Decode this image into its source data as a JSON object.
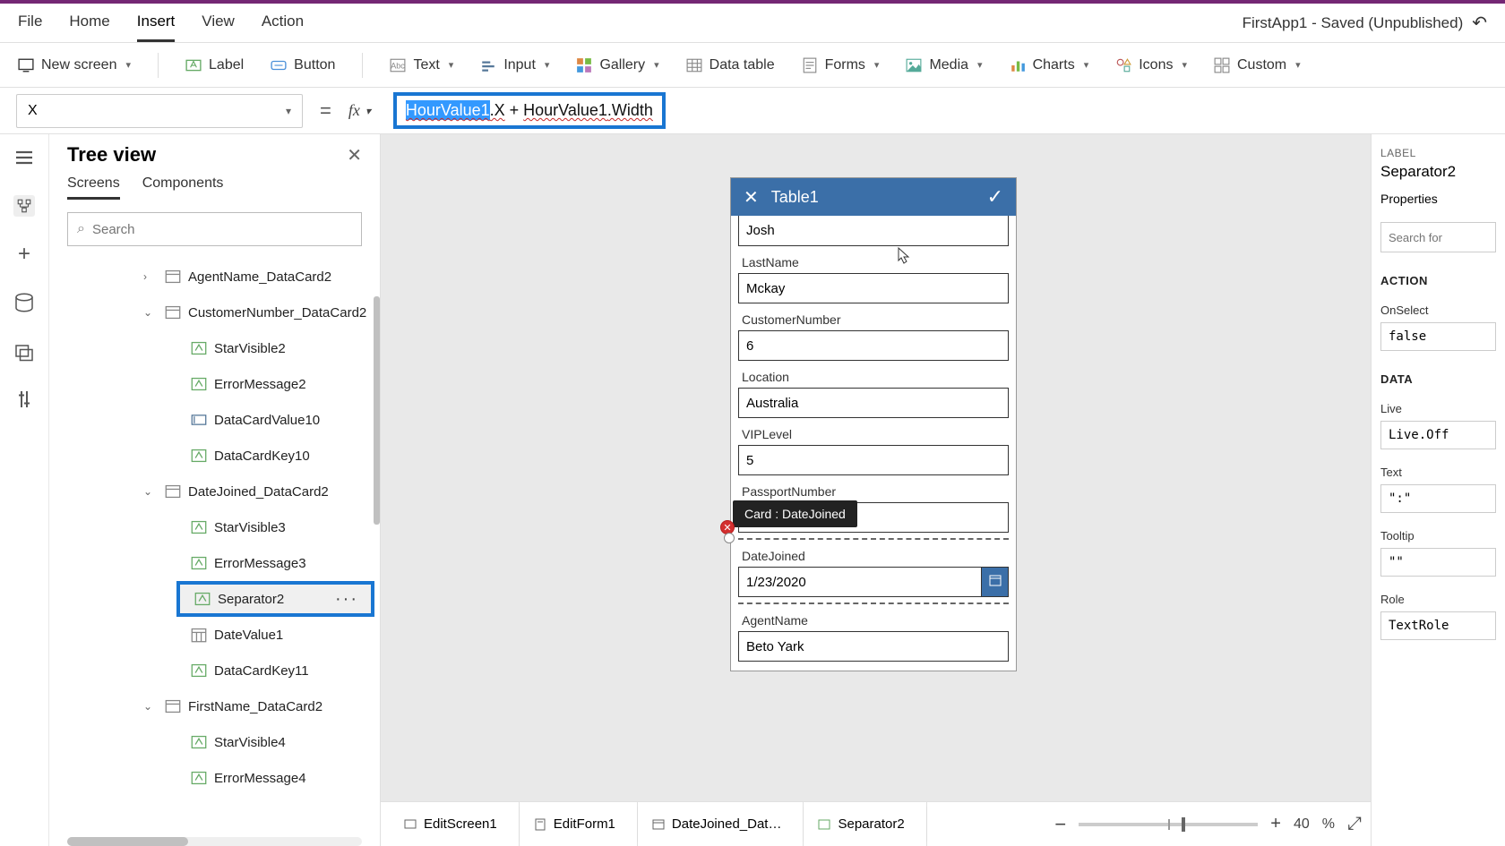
{
  "app_title": "FirstApp1 - Saved (Unpublished)",
  "menu": {
    "file": "File",
    "home": "Home",
    "insert": "Insert",
    "view": "View",
    "action": "Action"
  },
  "toolbar": {
    "new_screen": "New screen",
    "label": "Label",
    "button": "Button",
    "text": "Text",
    "input": "Input",
    "gallery": "Gallery",
    "data_table": "Data table",
    "forms": "Forms",
    "media": "Media",
    "charts": "Charts",
    "icons": "Icons",
    "custom": "Custom"
  },
  "formula": {
    "property": "X",
    "selected": "HourValue1",
    "part1": ".X",
    "op": " + ",
    "ref2a": "HourValue1",
    "ref2b": ".Width"
  },
  "tree": {
    "title": "Tree view",
    "tabs": {
      "screens": "Screens",
      "components": "Components"
    },
    "search_placeholder": "Search",
    "nodes": {
      "agent": "AgentName_DataCard2",
      "cust": "CustomerNumber_DataCard2",
      "sv2": "StarVisible2",
      "em2": "ErrorMessage2",
      "dcv10": "DataCardValue10",
      "dck10": "DataCardKey10",
      "dj": "DateJoined_DataCard2",
      "sv3": "StarVisible3",
      "em3": "ErrorMessage3",
      "sep2": "Separator2",
      "dv1": "DateValue1",
      "dck11": "DataCardKey11",
      "fn": "FirstName_DataCard2",
      "sv4": "StarVisible4",
      "em4": "ErrorMessage4"
    }
  },
  "form": {
    "title": "Table1",
    "fields": {
      "first_val": "Josh",
      "last_lbl": "LastName",
      "last_val": "Mckay",
      "cust_lbl": "CustomerNumber",
      "cust_val": "6",
      "loc_lbl": "Location",
      "loc_val": "Australia",
      "vip_lbl": "VIPLevel",
      "vip_val": "5",
      "pass_lbl": "PassportNumber",
      "pass_val": "",
      "dj_lbl": "DateJoined",
      "dj_val": "1/23/2020",
      "agent_lbl": "AgentName",
      "agent_val": "Beto Yark"
    },
    "tooltip": "Card : DateJoined"
  },
  "right": {
    "type": "LABEL",
    "name": "Separator2",
    "props_tab": "Properties",
    "search_placeholder": "Search for",
    "action": "ACTION",
    "onselect": "OnSelect",
    "onselect_val": "false",
    "data": "DATA",
    "live": "Live",
    "live_val": "Live.Off",
    "text": "Text",
    "text_val": "\":\"",
    "tooltip": "Tooltip",
    "tooltip_val": "\"\"",
    "role": "Role",
    "role_val": "TextRole"
  },
  "breadcrumb": {
    "b1": "EditScreen1",
    "b2": "EditForm1",
    "b3": "DateJoined_Dat…",
    "b4": "Separator2",
    "zoom": "40",
    "pct": "%"
  }
}
